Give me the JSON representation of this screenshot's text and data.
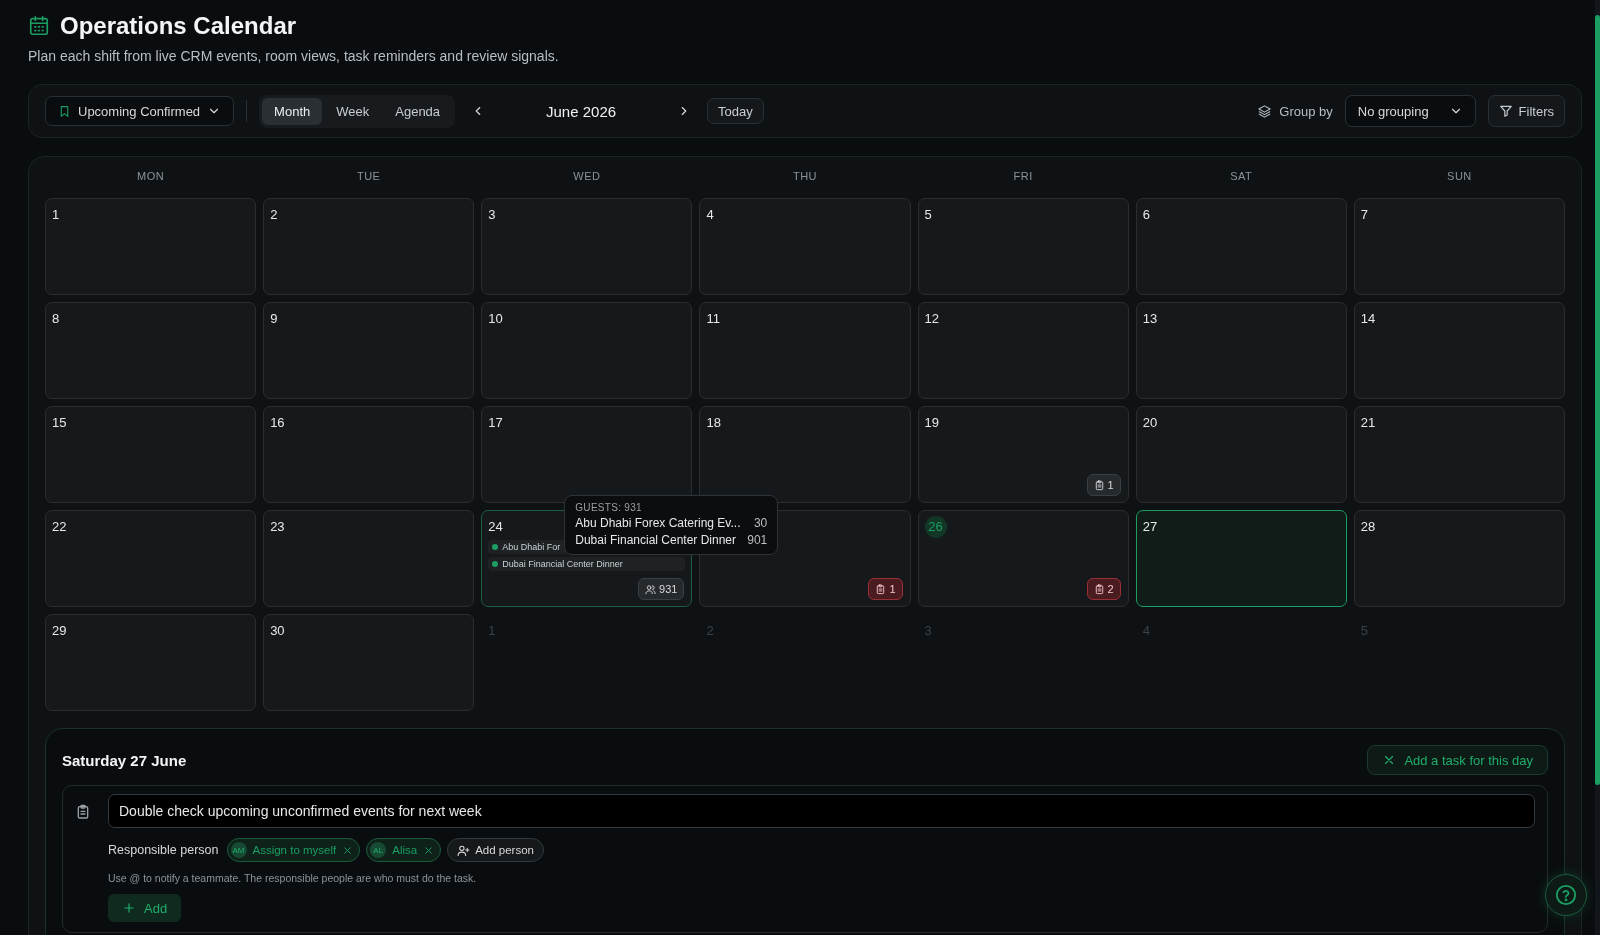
{
  "page": {
    "title": "Operations Calendar",
    "subtitle": "Plan each shift from live CRM events, room views, task reminders and review signals."
  },
  "toolbar": {
    "saved_view": "Upcoming Confirmed",
    "views": [
      {
        "label": "Month",
        "selected": true
      },
      {
        "label": "Week",
        "selected": false
      },
      {
        "label": "Agenda",
        "selected": false
      }
    ],
    "period": "June 2026",
    "today_button": "Today",
    "group_by_label": "Group by",
    "group_by_value": "No grouping",
    "filters_button": "Filters"
  },
  "calendar": {
    "weekdays": [
      "MON",
      "TUE",
      "WED",
      "THU",
      "FRI",
      "SAT",
      "SUN"
    ],
    "days": [
      {
        "kind": "current",
        "number": "1",
        "today": false,
        "selected": false
      },
      {
        "kind": "current",
        "number": "2",
        "today": false,
        "selected": false
      },
      {
        "kind": "current",
        "number": "3",
        "today": false,
        "selected": false
      },
      {
        "kind": "current",
        "number": "4",
        "today": false,
        "selected": false
      },
      {
        "kind": "current",
        "number": "5",
        "today": false,
        "selected": false
      },
      {
        "kind": "current",
        "number": "6",
        "today": false,
        "selected": false
      },
      {
        "kind": "current",
        "number": "7",
        "today": false,
        "selected": false
      },
      {
        "kind": "current",
        "number": "8",
        "today": false,
        "selected": false
      },
      {
        "kind": "current",
        "number": "9",
        "today": false,
        "selected": false
      },
      {
        "kind": "current",
        "number": "10",
        "today": false,
        "selected": false
      },
      {
        "kind": "current",
        "number": "11",
        "today": false,
        "selected": false
      },
      {
        "kind": "current",
        "number": "12",
        "today": false,
        "selected": false
      },
      {
        "kind": "current",
        "number": "13",
        "today": false,
        "selected": false
      },
      {
        "kind": "current",
        "number": "14",
        "today": false,
        "selected": false
      },
      {
        "kind": "current",
        "number": "15",
        "today": false,
        "selected": false
      },
      {
        "kind": "current",
        "number": "16",
        "today": false,
        "selected": false
      },
      {
        "kind": "current",
        "number": "17",
        "today": false,
        "selected": false
      },
      {
        "kind": "current",
        "number": "18",
        "today": false,
        "selected": false
      },
      {
        "kind": "current",
        "number": "19",
        "today": false,
        "selected": false,
        "badge": {
          "kind": "tasks",
          "count": "1",
          "overdue": false
        }
      },
      {
        "kind": "current",
        "number": "20",
        "today": false,
        "selected": false
      },
      {
        "kind": "current",
        "number": "21",
        "today": false,
        "selected": false
      },
      {
        "kind": "current",
        "number": "22",
        "today": false,
        "selected": false
      },
      {
        "kind": "current",
        "number": "23",
        "today": false,
        "selected": false
      },
      {
        "kind": "current",
        "number": "24",
        "today": false,
        "selected": false,
        "events": [
          {
            "title": "Abu Dhabi For",
            "color": "#1a9e63"
          },
          {
            "title": "Dubai Financial Center Dinner",
            "color": "#1a9e63"
          }
        ],
        "badge": {
          "kind": "guests",
          "count": "931",
          "overdue": false
        },
        "tooltip": {
          "title": "GUESTS: 931",
          "rows": [
            {
              "name": "Abu Dhabi Forex Catering Ev...",
              "value": "30"
            },
            {
              "name": "Dubai Financial Center Dinner",
              "value": "901"
            }
          ]
        }
      },
      {
        "kind": "current",
        "selected": false,
        "badge": {
          "kind": "tasks",
          "count": "1",
          "overdue": true
        }
      },
      {
        "kind": "current",
        "number": "26",
        "today": true,
        "selected": false,
        "badge": {
          "kind": "tasks",
          "count": "2",
          "overdue": true
        }
      },
      {
        "kind": "current",
        "number": "27",
        "today": false,
        "selected": true
      },
      {
        "kind": "current",
        "number": "28",
        "today": false,
        "selected": false
      },
      {
        "kind": "current",
        "number": "29",
        "today": false,
        "selected": false
      },
      {
        "kind": "current",
        "number": "30",
        "today": false,
        "selected": false
      },
      {
        "kind": "outside",
        "number": "1"
      },
      {
        "kind": "outside",
        "number": "2"
      },
      {
        "kind": "outside",
        "number": "3"
      },
      {
        "kind": "outside",
        "number": "4"
      },
      {
        "kind": "outside",
        "number": "5"
      }
    ]
  },
  "day_panel": {
    "title": "Saturday 27 June",
    "add_task_button": "Add a task for this day",
    "task": {
      "value": "Double check upcoming unconfirmed events for next week",
      "responsible_label": "Responsible person",
      "people": [
        {
          "initials": "AM",
          "name": "Assign to myself"
        },
        {
          "initials": "AL",
          "name": "Alisa"
        }
      ],
      "add_person_button": "Add person",
      "hint": "Use @ to notify a teammate. The responsible people are who must do the task.",
      "add_button": "Add"
    }
  }
}
